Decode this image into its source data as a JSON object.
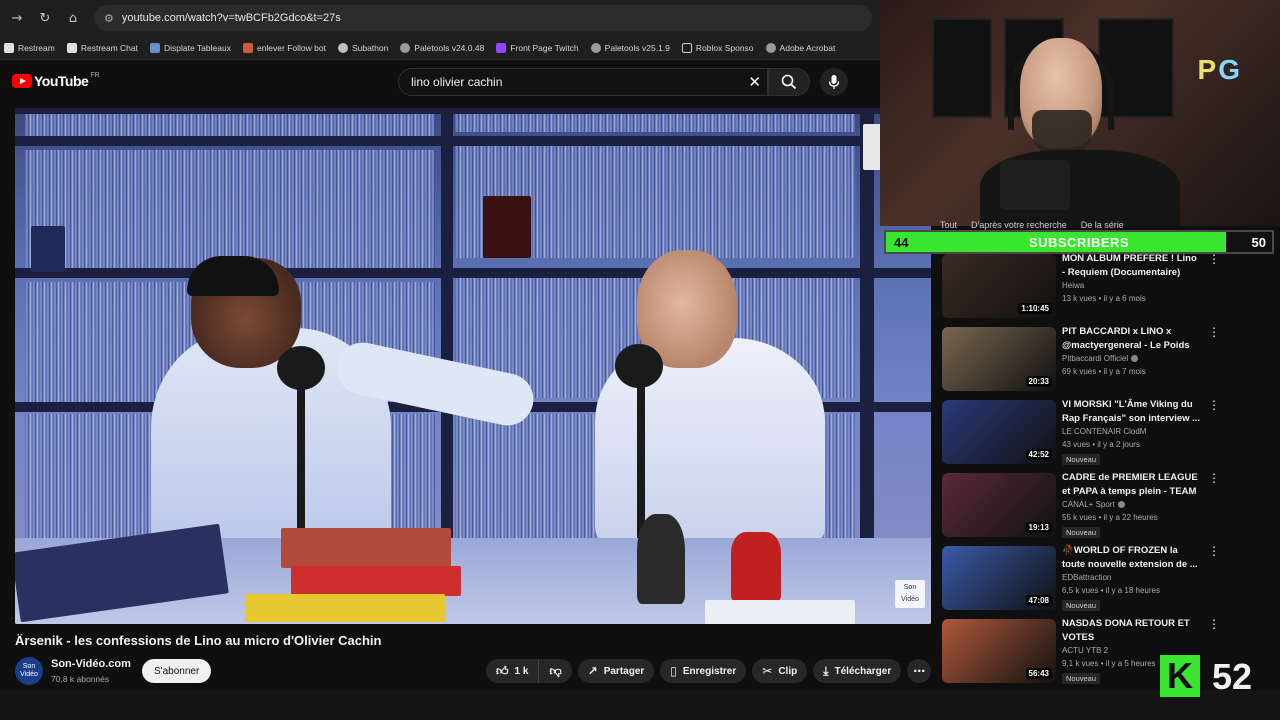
{
  "browser": {
    "url": "youtube.com/watch?v=twBCFb2Gdco&t=27s",
    "bookmarks": [
      "Restream",
      "Restream Chat",
      "Displate Tableaux",
      "enlever Follow bot",
      "Subathon",
      "Paletools v24.0.48",
      "Front Page Twitch",
      "Paletools v25.1.9",
      "Roblox Sponso",
      "Adobe Acrobat"
    ]
  },
  "header": {
    "logo_text": "YouTube",
    "region": "FR",
    "search_value": "lino olivier cachin"
  },
  "video": {
    "title": "Ärsenik - les confessions de Lino au micro d'Olivier Cachin",
    "channel_name": "Son-Vidéo.com",
    "channel_subs": "70,8 k abonnés",
    "subscribe_label": "S'abonner",
    "avatar_text": "Son Vidéo",
    "watermark_text": "Son Vidéo"
  },
  "actions": {
    "like_count": "1 k",
    "share": "Partager",
    "save": "Enregistrer",
    "clip": "Clip",
    "download": "Télécharger"
  },
  "overlay": {
    "logo_p": "P",
    "logo_g": "G",
    "sub_current": "44",
    "sub_label": "SUBSCRIBERS",
    "sub_goal": "50",
    "sub_progress": 0.88,
    "chips": [
      "Tout",
      "D'après votre recherche",
      "De la série"
    ],
    "k_letter": "K",
    "k_count": "52",
    "accent": "#39e52e"
  },
  "recommendations": [
    {
      "title": "MON ALBUM PREFERE ! Lino - Requiem (Documentaire)",
      "channel": "Heiwa",
      "meta": "13 k vues • il y a 6 mois",
      "duration": "1:10:45",
      "badge": "",
      "verified": false,
      "thumb": "#3a2a22"
    },
    {
      "title": "PIT BACCARDI x LINO x @mactyergeneral - Le Poids d...",
      "channel": "Pitbaccardi Officiel",
      "meta": "69 k vues • il y a 7 mois",
      "duration": "20:33",
      "badge": "",
      "verified": true,
      "thumb": "#7a6650"
    },
    {
      "title": "VI MORSKI \"L'Âme Viking du Rap Français\" son interview ...",
      "channel": "LE CONTENAIR ClodM",
      "meta": "43 vues • il y a 2 jours",
      "duration": "42:52",
      "badge": "Nouveau",
      "verified": false,
      "thumb": "#2b3a7a"
    },
    {
      "title": "CADRE de PREMIER LEAGUE et PAPA à temps plein - TEAM ...",
      "channel": "CANAL+ Sport",
      "meta": "55 k vues • il y a 22 heures",
      "duration": "19:13",
      "badge": "Nouveau",
      "verified": true,
      "thumb": "#5a2a3a"
    },
    {
      "title": "🥀WORLD OF FROZEN la toute nouvelle extension de ...",
      "channel": "EDBattraction",
      "meta": "6,5 k vues • il y a 18 heures",
      "duration": "47:08",
      "badge": "Nouveau",
      "verified": false,
      "thumb": "#3a5aa8"
    },
    {
      "title": "NASDAS DONA RETOUR ET VOTES",
      "channel": "ACTU YTB 2",
      "meta": "9,1 k vues • il y a 5 heures",
      "duration": "56:43",
      "badge": "Nouveau",
      "verified": false,
      "thumb": "#b0583a"
    }
  ]
}
